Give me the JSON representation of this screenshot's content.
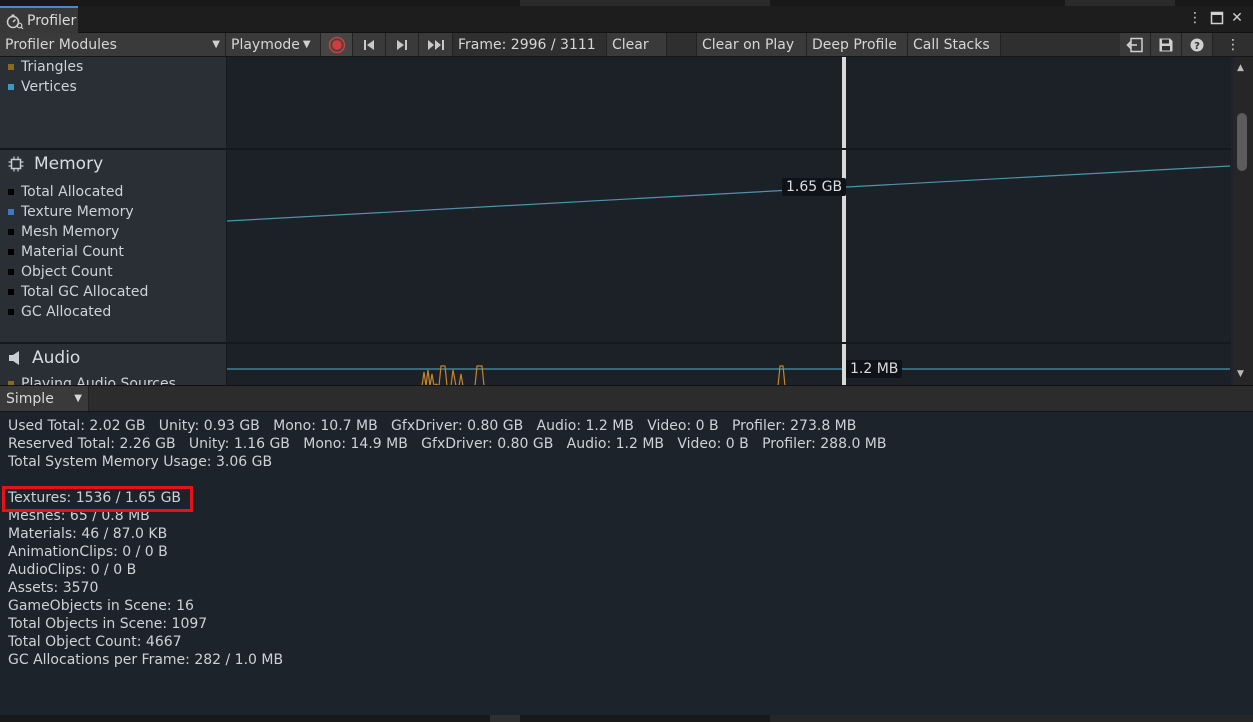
{
  "window": {
    "tab_title": "Profiler",
    "icons": {
      "tab": "profiler-stopwatch-icon",
      "more": "kebab-menu-icon",
      "maximize": "maximize-icon",
      "close": "close-icon"
    }
  },
  "toolbar": {
    "modules_dropdown": "Profiler Modules",
    "target_dropdown": "Playmode",
    "frame_label": "Frame: 2996 / 3111",
    "clear": "Clear",
    "clear_on_play": "Clear on Play",
    "deep_profile": "Deep Profile",
    "call_stacks": "Call Stacks",
    "icons": {
      "record": "record-icon",
      "first_frame": "first-frame-icon",
      "next_frame": "step-frame-icon",
      "last_frame": "last-frame-icon",
      "load": "load-icon",
      "save": "save-icon",
      "help": "help-icon",
      "more": "kebab-menu-icon"
    }
  },
  "modules": {
    "rendering_partial": {
      "legend": [
        {
          "label": "Triangles",
          "color": "#8a6a1a"
        },
        {
          "label": "Vertices",
          "color": "#3a9ac4"
        }
      ]
    },
    "memory": {
      "title": "Memory",
      "icon": "memory-chip-icon",
      "legend": [
        {
          "label": "Total Allocated",
          "color": "#000000"
        },
        {
          "label": "Texture Memory",
          "color": "#3a7ac4"
        },
        {
          "label": "Mesh Memory",
          "color": "#000000"
        },
        {
          "label": "Material Count",
          "color": "#000000"
        },
        {
          "label": "Object Count",
          "color": "#000000"
        },
        {
          "label": "Total GC Allocated",
          "color": "#000000"
        },
        {
          "label": "GC Allocated",
          "color": "#000000"
        }
      ],
      "cursor_value": "1.65 GB",
      "line_color": "#4a95ad"
    },
    "audio": {
      "title": "Audio",
      "icon": "speaker-icon",
      "legend_partial": "Playing Audio Sources",
      "cursor_value": "1.2 MB",
      "line_color": "#4a95ad",
      "spike_color": "#c7842a"
    }
  },
  "details": {
    "view_mode": "Simple",
    "lines": [
      "Used Total: 2.02 GB   Unity: 0.93 GB   Mono: 10.7 MB   GfxDriver: 0.80 GB   Audio: 1.2 MB   Video: 0 B   Profiler: 273.8 MB",
      "Reserved Total: 2.26 GB   Unity: 1.16 GB   Mono: 14.9 MB   GfxDriver: 0.80 GB   Audio: 1.2 MB   Video: 0 B   Profiler: 288.0 MB",
      "Total System Memory Usage: 3.06 GB",
      "",
      "Textures: 1536 / 1.65 GB",
      "Meshes: 65 / 0.8 MB",
      "Materials: 46 / 87.0 KB",
      "AnimationClips: 0 / 0 B",
      "AudioClips: 0 / 0 B",
      "Assets: 3570",
      "GameObjects in Scene: 16",
      "Total Objects in Scene: 1097",
      "Total Object Count: 4667",
      "GC Allocations per Frame: 282 / 1.0 MB"
    ],
    "highlight_color": "#e5121a"
  }
}
